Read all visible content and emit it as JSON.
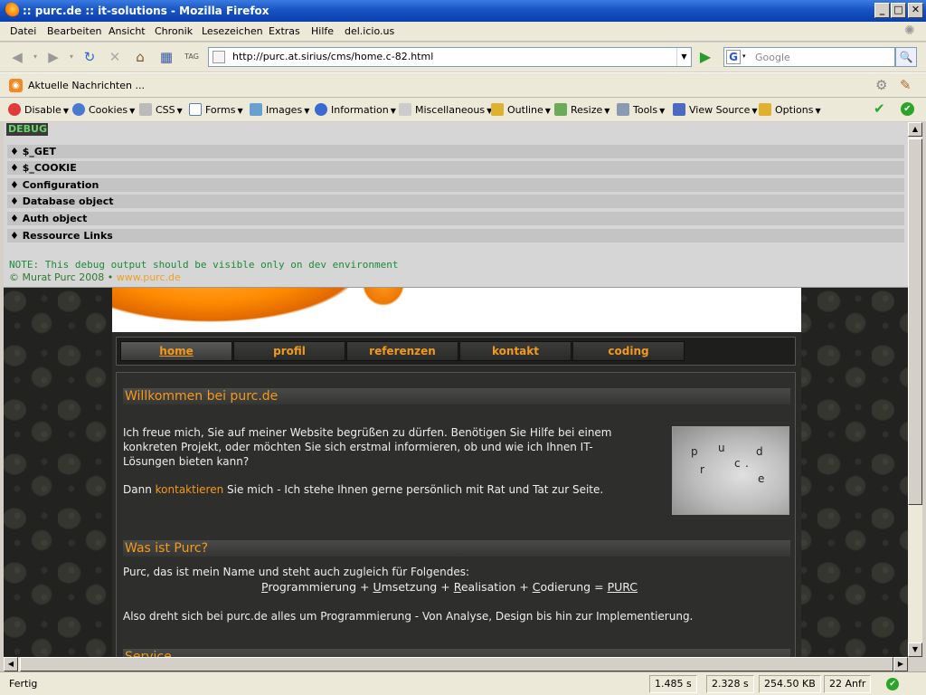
{
  "window": {
    "title": ":: purc.de :: it-solutions - Mozilla Firefox"
  },
  "menu": [
    "Datei",
    "Bearbeiten",
    "Ansicht",
    "Chronik",
    "Lesezeichen",
    "Extras",
    "Hilfe",
    "del.icio.us"
  ],
  "nav": {
    "url": "http://purc.at.sirius/cms/home.c-82.html",
    "search_placeholder": "Google"
  },
  "bookmarks": {
    "item": "Aktuelle Nachrichten ..."
  },
  "devbar": [
    "Disable",
    "Cookies",
    "CSS",
    "Forms",
    "Images",
    "Information",
    "Miscellaneous",
    "Outline",
    "Resize",
    "Tools",
    "View Source",
    "Options"
  ],
  "debug": {
    "tag": "DEBUG",
    "rows": [
      "♦ $_GET",
      "♦ $_COOKIE",
      "♦ Configuration",
      "♦ Database object",
      "♦ Auth object",
      "♦ Ressource Links"
    ],
    "note": "NOTE: This debug output should be visible only on dev environment",
    "copyright": "© Murat Purc 2008 •",
    "copyright_link": "www.purc.de"
  },
  "site": {
    "tabs": [
      "home",
      "profil",
      "referenzen",
      "kontakt",
      "coding"
    ],
    "active_tab": "home",
    "welcome_title": "Willkommen bei purc.de",
    "welcome_p1": "Ich freue mich, Sie auf meiner Website begrüßen zu dürfen. Benötigen Sie Hilfe bei einem konkreten Projekt, oder möchten Sie sich erstmal informieren, ob und wie ich Ihnen IT-Lösungen bieten kann?",
    "welcome_p2_prefix": "Dann",
    "welcome_p2_link": "kontaktieren",
    "welcome_p2_suffix": "Sie mich - Ich stehe Ihnen gerne persönlich mit Rat und Tat zur Seite.",
    "puzzle_letters": [
      "p",
      "u",
      "r",
      "c",
      ".",
      "d",
      "e"
    ],
    "purc_title": "Was ist Purc?",
    "purc_p1": "Purc, das ist mein Name und steht auch zugleich für Folgendes:",
    "purc_p2": {
      "w1_first": "P",
      "w1_rest": "rogrammierung",
      "w2_first": "U",
      "w2_rest": "msetzung",
      "w3_first": "R",
      "w3_rest": "ealisation",
      "w4_first": "C",
      "w4_rest": "odierung",
      "sep": "+",
      "eq": "=",
      "result": "PURC"
    },
    "purc_p3": "Also dreht sich bei purc.de alles um Programmierung - Von Analyse, Design bis hin zur Implementierung.",
    "service_title": "Service"
  },
  "status": {
    "text": "Fertig",
    "t1": "1.485 s",
    "t2": "2.328 s",
    "size": "254.50 KB",
    "requests": "22 Anfr"
  }
}
